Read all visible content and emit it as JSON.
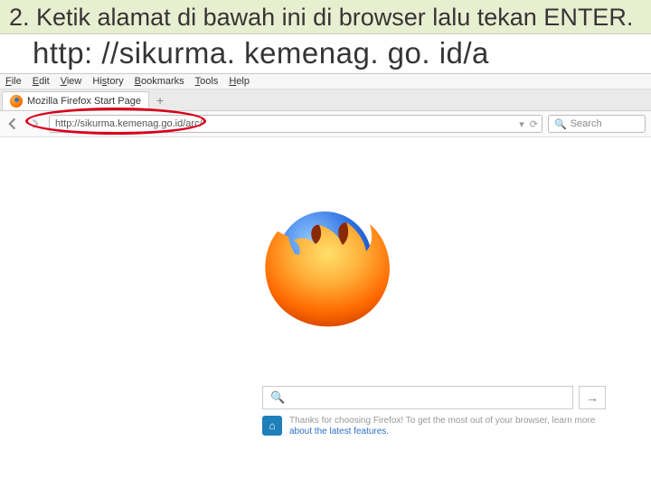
{
  "instruction": "2. Ketik alamat di bawah ini di browser lalu tekan ENTER.",
  "display_url": "http: //sikurma. kemenag. go. id/a",
  "menubar": {
    "file": "File",
    "edit": "Edit",
    "view": "View",
    "history": "History",
    "bookmarks": "Bookmarks",
    "tools": "Tools",
    "help": "Help"
  },
  "tab": {
    "title": "Mozilla Firefox Start Page"
  },
  "addressbar": {
    "url": "http://sikurma.kemenag.go.id/arc/",
    "reload": "⟳"
  },
  "searchbox": {
    "placeholder": "Search",
    "icon": "🔍"
  },
  "startpage": {
    "search_go": "→",
    "promo_line1": "Thanks for choosing Firefox! To get the most out of your browser, learn more",
    "promo_line2": "about the latest features."
  }
}
